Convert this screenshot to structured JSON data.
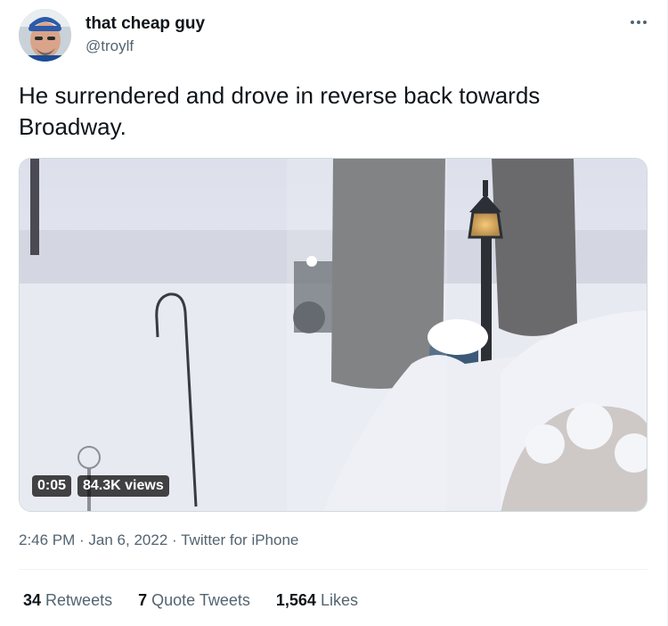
{
  "author": {
    "name": "that cheap guy",
    "handle": "@troylf",
    "avatar_icon": "profile-photo"
  },
  "more_icon": "more-horizontal-icon",
  "tweet_text": "He surrendered and drove in reverse back towards Broadway.",
  "media": {
    "type": "video",
    "description_icon": "snow-scene-video-thumbnail",
    "duration": "0:05",
    "views": "84.3K views"
  },
  "meta": {
    "time": "2:46 PM",
    "separator1": " · ",
    "date": "Jan 6, 2022",
    "separator2": " · ",
    "source": "Twitter for iPhone"
  },
  "stats": [
    {
      "count": "34",
      "label": "Retweets"
    },
    {
      "count": "7",
      "label": "Quote Tweets"
    },
    {
      "count": "1,564",
      "label": "Likes"
    }
  ],
  "colors": {
    "text": "#0f1419",
    "secondary": "#536471",
    "border": "#eff3f4"
  }
}
